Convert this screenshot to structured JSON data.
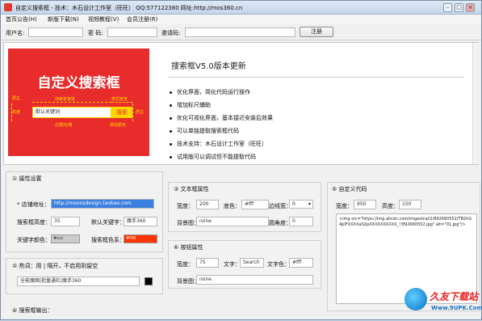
{
  "window": {
    "title": "自定义搜索框 - 技术：木石设计工作室（旺旺）  QQ:577122380  网址:http://mos360.cn"
  },
  "menu": [
    "首页公告(H)",
    "新版下载(N)",
    "视频教程(V)",
    "会员注册(R)"
  ],
  "register": {
    "username_label": "用户名:",
    "password_label": "密  码:",
    "invite_label": "邀请码:",
    "submit_label": "注册"
  },
  "preview": {
    "banner": {
      "headline": "自定义搜索框",
      "search_placeholder": "默认关键词",
      "search_button": "搜索",
      "annotations": {
        "margin_left": "居左",
        "height": "高度",
        "keyword_width": "搜索条宽度",
        "button_width": "按钮宽度",
        "margin_right": "居右",
        "border_color": "边框线/粗",
        "button_color": "按钮颜色"
      }
    },
    "version_title": "搜索框V5.0版本更新",
    "notes": [
      "优化界面，简化代码运行操作",
      "增加标尺辅助",
      "优化可视化界面，基本接近安装后效果",
      "可以单独提取搜索框代码",
      "技术支持：木石设计工作室（旺旺）",
      "试用版可以调试但不能提取代码"
    ]
  },
  "attr_panel": {
    "title": "① 属性设置",
    "store_label": "* 店铺地址：",
    "store_value": "http://moonsdesign.taobao.com",
    "search_height_label": "搜索框高度：",
    "search_height_value": "35",
    "default_kw_label": "默认关键字：",
    "default_kw_value": "魔手360",
    "kw_color_label": "关键字颜色：",
    "kw_color_value": "#ccc",
    "border_color_label": "搜索框色系：",
    "border_color_value": "#f30"
  },
  "hot_panel": {
    "title": "② 热词：用 | 隔开，不启用则留空",
    "value": "全能魔图|批量通栏|魔手360"
  },
  "output_panel": {
    "title": "④ 搜索框输出："
  },
  "text_panel": {
    "title": "③ 文本框属性",
    "width_label": "宽度：",
    "width_value": "200",
    "bg_label": "底色：",
    "bg_value": "#fff",
    "border_label": "边线宽：",
    "border_value": "0",
    "bgimg_label": "背景图：",
    "bgimg_value": "none",
    "round_label": "圆角度：",
    "round_value": "0"
  },
  "btn_panel": {
    "title": "⑥ 按钮属性",
    "width_label": "宽度：",
    "width_value": "75",
    "text_label": "文字：",
    "text_value": "Search",
    "color_label": "文字色：",
    "color_value": "#fff",
    "bgimg_label": "背景图：",
    "bgimg_value": "none"
  },
  "code_panel": {
    "title": "⑤ 自定义代码",
    "width_label": "宽度：",
    "width_value": "950",
    "height_label": "高度：",
    "height_value": "150",
    "code": "<img src=\"https://img.alicdn.com/imgextra/i2/892660552/TB2hG4pIFXXXXaSXpXXXXXXXXXX_!!892660552.jpg\" alt=\"01.jpg\"/>"
  },
  "watermark": {
    "text": "久友下载站",
    "url": "Www.9UPK.Com"
  }
}
